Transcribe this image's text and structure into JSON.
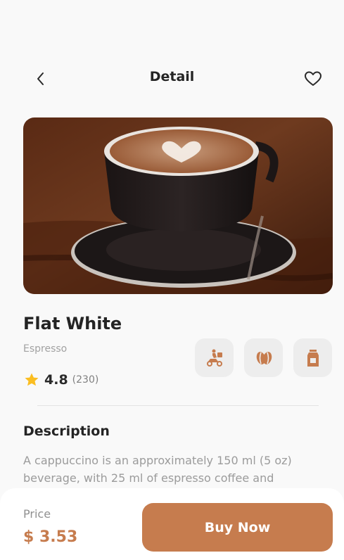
{
  "header": {
    "title": "Detail",
    "back_icon": "chevron-left-icon",
    "favorite_icon": "heart-outline-icon"
  },
  "product": {
    "name": "Flat White",
    "category": "Espresso",
    "rating": "4.8",
    "rating_count": "(230)",
    "image": "coffee-cup-photo",
    "features": [
      {
        "icon": "delivery-scooter-icon"
      },
      {
        "icon": "coffee-bean-icon"
      },
      {
        "icon": "milk-carton-icon"
      }
    ]
  },
  "description": {
    "title": "Description",
    "text": "A cappuccino is an approximately 150 ml (5 oz) beverage, with 25 ml of espresso coffee and"
  },
  "footer": {
    "price_label": "Price",
    "price_value": "$ 3.53",
    "buy_label": "Buy Now"
  },
  "colors": {
    "accent": "#C67C4E",
    "star": "#FBBE21",
    "text_dark": "#242424",
    "text_muted": "#A2A2A2"
  }
}
